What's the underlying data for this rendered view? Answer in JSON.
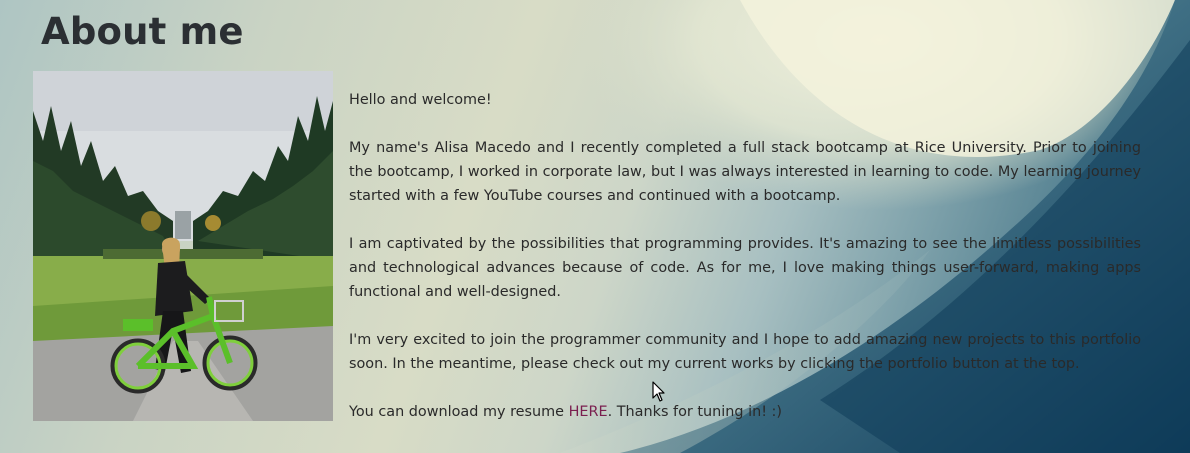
{
  "page": {
    "title": "About me"
  },
  "photo": {
    "alt": "Alisa on a green bike in a park"
  },
  "about": {
    "greeting": "Hello and welcome!",
    "paragraph_1": "My name's Alisa Macedo and I recently completed a full stack bootcamp at Rice University. Prior to joining the bootcamp, I worked in corporate law, but I was always interested in learning to code. My learning journey started with a few YouTube courses and continued with a bootcamp.",
    "paragraph_2": "I am captivated by the possibilities that programming provides. It's amazing to see the limitless possibilities and technological advances because of code. As for me, I love making things user-forward, making apps functional and well-designed.",
    "paragraph_3": "I'm very excited to join the programmer community and I hope to add amazing new projects to this portfolio soon. In the meantime, please check out my current works by clicking the portfolio button at the top.",
    "resume_prefix": "You can download my resume ",
    "resume_link": "HERE",
    "resume_suffix": ". Thanks for tuning in! :)"
  },
  "colors": {
    "link": "#7a1f4f",
    "title": "#2b2f33",
    "text": "#2a2a2a"
  }
}
